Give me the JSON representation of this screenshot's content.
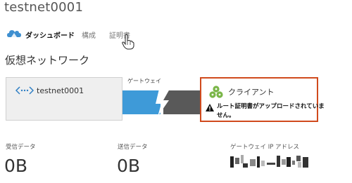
{
  "header": {
    "title": "testnet0001"
  },
  "nav": {
    "items": [
      "ダッシュボード",
      "構成",
      "証明書"
    ]
  },
  "section": {
    "title": "仮想ネットワーク"
  },
  "diagram": {
    "network_name": "testnet0001",
    "gateway_label": "ゲートウェイ",
    "client_label": "クライアント",
    "warning_line1": "ルート証明書がアップロードされていま",
    "warning_line2": "せん。",
    "colors": {
      "gateway_blue": "#3e9ad8",
      "gateway_gray": "#595959",
      "alert_border": "#d04a1d",
      "client_green": "#7ab648"
    }
  },
  "stats": {
    "received_label": "受信データ",
    "received_value": "0B",
    "sent_label": "送信データ",
    "sent_value": "0B",
    "gateway_ip_label": "ゲートウェイ IP アドレス"
  },
  "icons": {
    "nav": "cloud-icon",
    "network": "network-brackets-icon",
    "client": "client-cluster-icon",
    "warning": "warning-icon",
    "cursor": "hand-cursor-icon"
  }
}
